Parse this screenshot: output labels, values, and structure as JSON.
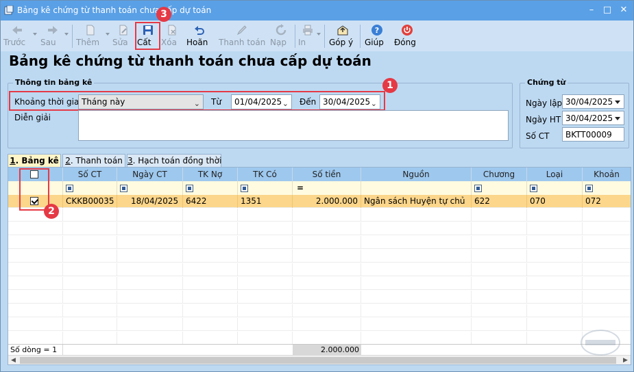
{
  "window": {
    "title": "Bảng kê chứng từ thanh toán chưa cấp dự toán",
    "controls": [
      "–",
      "□",
      "✕"
    ]
  },
  "toolbar": {
    "prev": "Trước",
    "next": "Sau",
    "add": "Thêm",
    "edit": "Sửa",
    "save": "Cất",
    "delete": "Xóa",
    "undo": "Hoãn",
    "pay": "Thanh toán",
    "load": "Nạp",
    "print": "In",
    "feedback": "Góp ý",
    "help": "Giúp",
    "close": "Đóng"
  },
  "page_title": "Bảng kê chứng từ thanh toán chưa cấp dự toán",
  "info": {
    "group_title": "Thông tin bảng kê",
    "period_label": "Khoảng thời gian",
    "period_value": "Tháng này",
    "from_label": "Từ",
    "from_value": "01/04/2025",
    "to_label": "Đến",
    "to_value": "30/04/2025",
    "desc_label": "Diễn giải",
    "desc_value": ""
  },
  "voucher": {
    "group_title": "Chứng từ",
    "date_label": "Ngày lập",
    "date_value": "30/04/2025",
    "ht_label": "Ngày HT",
    "ht_value": "30/04/2025",
    "no_label": "Số CT",
    "no_value": "BKTT00009"
  },
  "tabs": [
    {
      "num": "1",
      "label": ". Bảng kê"
    },
    {
      "num": "2",
      "label": ". Thanh toán"
    },
    {
      "num": "3",
      "label": ". Hạch toán đồng thời"
    }
  ],
  "grid": {
    "headers": [
      "Số CT",
      "Ngày CT",
      "TK Nợ",
      "TK Có",
      "Số tiền",
      "Nguồn",
      "Chương",
      "Loại",
      "Khoản"
    ],
    "filter_eq": "=",
    "rows": [
      {
        "checked": true,
        "cells": [
          "CKKB00035",
          "18/04/2025",
          "6422",
          "1351",
          "2.000.000",
          "Ngân sách Huyện tự chủ",
          "622",
          "070",
          "072"
        ]
      }
    ],
    "summary_label": "Số dòng = 1",
    "summary_total": "2.000.000"
  },
  "badges": [
    "1",
    "2",
    "3"
  ],
  "colors": {
    "titlebar": "#5aa0e6",
    "background": "#bdd9f2",
    "highlight": "#e53945",
    "selected_row": "#fbd68b",
    "grid_header": "#9ec8ee"
  }
}
